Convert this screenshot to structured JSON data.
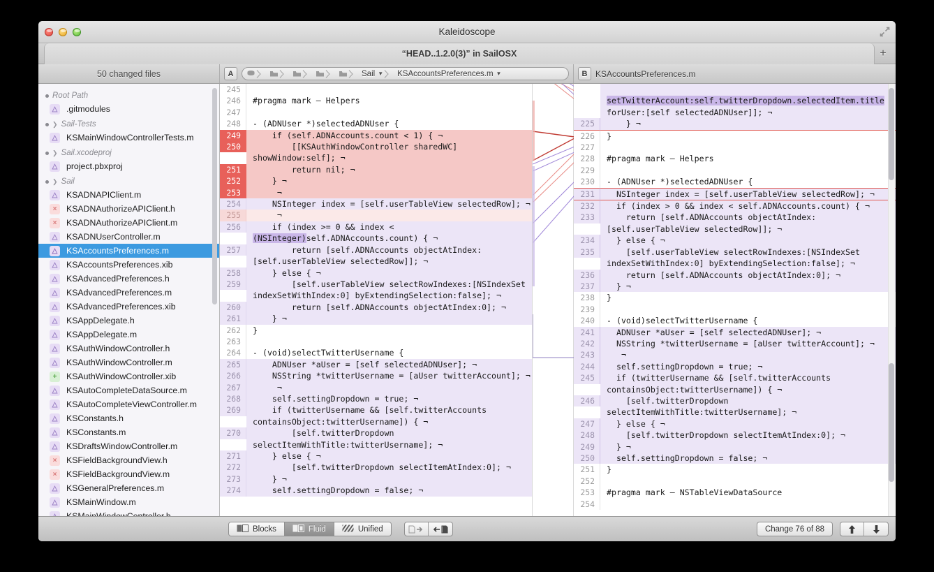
{
  "window": {
    "title": "Kaleidoscope",
    "subtitle": "“HEAD..1.2.0(3)” in SailOSX",
    "new_tab_label": "+"
  },
  "sidebar": {
    "header": "50 changed files",
    "groups": [
      {
        "name": "Root Path",
        "collapsible": false,
        "files": [
          {
            "name": ".gitmodules",
            "status": "mod"
          }
        ]
      },
      {
        "name": "Sail-Tests",
        "collapsible": true,
        "files": [
          {
            "name": "KSMainWindowControllerTests.m",
            "status": "mod"
          }
        ]
      },
      {
        "name": "Sail.xcodeproj",
        "collapsible": true,
        "files": [
          {
            "name": "project.pbxproj",
            "status": "mod"
          }
        ]
      },
      {
        "name": "Sail",
        "collapsible": true,
        "files": [
          {
            "name": "KSADNAPIClient.m",
            "status": "mod"
          },
          {
            "name": "KSADNAuthorizeAPIClient.h",
            "status": "del"
          },
          {
            "name": "KSADNAuthorizeAPIClient.m",
            "status": "del"
          },
          {
            "name": "KSADNUserController.m",
            "status": "mod"
          },
          {
            "name": "KSAccountsPreferences.m",
            "status": "mod",
            "selected": true
          },
          {
            "name": "KSAccountsPreferences.xib",
            "status": "mod"
          },
          {
            "name": "KSAdvancedPreferences.h",
            "status": "mod"
          },
          {
            "name": "KSAdvancedPreferences.m",
            "status": "mod"
          },
          {
            "name": "KSAdvancedPreferences.xib",
            "status": "mod"
          },
          {
            "name": "KSAppDelegate.h",
            "status": "mod"
          },
          {
            "name": "KSAppDelegate.m",
            "status": "mod"
          },
          {
            "name": "KSAuthWindowController.h",
            "status": "mod"
          },
          {
            "name": "KSAuthWindowController.m",
            "status": "mod"
          },
          {
            "name": "KSAuthWindowController.xib",
            "status": "add"
          },
          {
            "name": "KSAutoCompleteDataSource.m",
            "status": "mod"
          },
          {
            "name": "KSAutoCompleteViewController.m",
            "status": "mod"
          },
          {
            "name": "KSConstants.h",
            "status": "mod"
          },
          {
            "name": "KSConstants.m",
            "status": "mod"
          },
          {
            "name": "KSDraftsWindowController.m",
            "status": "mod"
          },
          {
            "name": "KSFieldBackgroundView.h",
            "status": "del"
          },
          {
            "name": "KSFieldBackgroundView.m",
            "status": "del"
          },
          {
            "name": "KSGeneralPreferences.m",
            "status": "mod"
          },
          {
            "name": "KSMainWindow.m",
            "status": "mod"
          },
          {
            "name": "KSMainWindowController.h",
            "status": "mod"
          }
        ]
      }
    ]
  },
  "pane_a": {
    "badge": "A",
    "breadcrumbs": [
      "Sail",
      "KSAccountsPreferences.m"
    ],
    "lines": [
      {
        "n": "245",
        "state": "",
        "code": ""
      },
      {
        "n": "246",
        "state": "",
        "code": "#pragma mark — Helpers"
      },
      {
        "n": "247",
        "state": "",
        "code": ""
      },
      {
        "n": "248",
        "state": "",
        "code": "- (ADNUser *)selectedADNUser {"
      },
      {
        "n": "249",
        "state": "del",
        "code": "    if (self.ADNAccounts.count < 1) { ¬"
      },
      {
        "n": "250",
        "state": "del",
        "code": "        [[KSAuthWindowController sharedWC] showWindow:self]; ¬"
      },
      {
        "n": "251",
        "state": "del",
        "code": "        return nil; ¬"
      },
      {
        "n": "252",
        "state": "del",
        "code": "    } ¬"
      },
      {
        "n": "253",
        "state": "del",
        "code": "     ¬"
      },
      {
        "n": "254",
        "state": "chg",
        "code": "    NSInteger index = [self.userTableView selectedRow]; ¬"
      },
      {
        "n": "255",
        "state": "delsoft",
        "code": "     ¬"
      },
      {
        "n": "256",
        "state": "chg",
        "code": "    if (index >= 0 && index < (NSInteger)self.ADNAccounts.count) { ¬"
      },
      {
        "n": "257",
        "state": "chg",
        "code": "        return [self.ADNAccounts objectAtIndex:[self.userTableView selectedRow]]; ¬"
      },
      {
        "n": "258",
        "state": "chg",
        "code": "    } else { ¬"
      },
      {
        "n": "259",
        "state": "chg",
        "code": "        [self.userTableView selectRowIndexes:[NSIndexSet indexSetWithIndex:0] byExtendingSelection:false]; ¬"
      },
      {
        "n": "260",
        "state": "chg",
        "code": "        return [self.ADNAccounts objectAtIndex:0]; ¬"
      },
      {
        "n": "261",
        "state": "chg",
        "code": "    } ¬"
      },
      {
        "n": "262",
        "state": "",
        "code": "}"
      },
      {
        "n": "263",
        "state": "",
        "code": ""
      },
      {
        "n": "264",
        "state": "",
        "code": "- (void)selectTwitterUsername {"
      },
      {
        "n": "265",
        "state": "chg",
        "code": "    ADNUser *aUser = [self selectedADNUser]; ¬"
      },
      {
        "n": "266",
        "state": "chg",
        "code": "    NSString *twitterUsername = [aUser twitterAccount]; ¬"
      },
      {
        "n": "267",
        "state": "chg",
        "code": "     ¬"
      },
      {
        "n": "268",
        "state": "chg",
        "code": "    self.settingDropdown = true; ¬"
      },
      {
        "n": "269",
        "state": "chg",
        "code": "    if (twitterUsername && [self.twitterAccounts containsObject:twitterUsername]) { ¬"
      },
      {
        "n": "270",
        "state": "chg",
        "code": "        [self.twitterDropdown selectItemWithTitle:twitterUsername]; ¬"
      },
      {
        "n": "271",
        "state": "chg",
        "code": "    } else { ¬"
      },
      {
        "n": "272",
        "state": "chg",
        "code": "        [self.twitterDropdown selectItemAtIndex:0]; ¬"
      },
      {
        "n": "273",
        "state": "chg",
        "code": "    } ¬"
      },
      {
        "n": "274",
        "state": "chg",
        "code": "    self.settingDropdown = false; ¬"
      }
    ]
  },
  "pane_b": {
    "badge": "B",
    "filename": "KSAccountsPreferences.m",
    "lines": [
      {
        "n": "",
        "state": "chgb",
        "code": "    setTwitterAccount:self.twitterDropdown.selectedItem.title forUser:[self selectedADNUser]]; ¬"
      },
      {
        "n": "225",
        "state": "chgb outline-bottom",
        "code": "    } ¬"
      },
      {
        "n": "226",
        "state": "",
        "code": "}"
      },
      {
        "n": "227",
        "state": "",
        "code": ""
      },
      {
        "n": "228",
        "state": "",
        "code": "#pragma mark — Helpers"
      },
      {
        "n": "229",
        "state": "",
        "code": ""
      },
      {
        "n": "230",
        "state": "",
        "code": "- (ADNUser *)selectedADNUser {"
      },
      {
        "n": "231",
        "state": "chgb outline-top outline-bottom",
        "code": "  NSInteger index = [self.userTableView selectedRow]; ¬"
      },
      {
        "n": "232",
        "state": "chgb",
        "code": "  if (index > 0 && index < self.ADNAccounts.count) { ¬"
      },
      {
        "n": "233",
        "state": "chgb",
        "code": "    return [self.ADNAccounts objectAtIndex:[self.userTableView selectedRow]]; ¬"
      },
      {
        "n": "234",
        "state": "chgb",
        "code": "  } else { ¬"
      },
      {
        "n": "235",
        "state": "chgb",
        "code": "    [self.userTableView selectRowIndexes:[NSIndexSet indexSetWithIndex:0] byExtendingSelection:false]; ¬"
      },
      {
        "n": "236",
        "state": "chgb",
        "code": "    return [self.ADNAccounts objectAtIndex:0]; ¬"
      },
      {
        "n": "237",
        "state": "chgb",
        "code": "  } ¬"
      },
      {
        "n": "238",
        "state": "",
        "code": "}"
      },
      {
        "n": "239",
        "state": "",
        "code": ""
      },
      {
        "n": "240",
        "state": "",
        "code": "- (void)selectTwitterUsername {"
      },
      {
        "n": "241",
        "state": "chgb",
        "code": "  ADNUser *aUser = [self selectedADNUser]; ¬"
      },
      {
        "n": "242",
        "state": "chgb",
        "code": "  NSString *twitterUsername = [aUser twitterAccount]; ¬"
      },
      {
        "n": "243",
        "state": "chgb",
        "code": "   ¬"
      },
      {
        "n": "244",
        "state": "chgb",
        "code": "  self.settingDropdown = true; ¬"
      },
      {
        "n": "245",
        "state": "chgb",
        "code": "  if (twitterUsername && [self.twitterAccounts containsObject:twitterUsername]) { ¬"
      },
      {
        "n": "246",
        "state": "chgb",
        "code": "    [self.twitterDropdown selectItemWithTitle:twitterUsername]; ¬"
      },
      {
        "n": "247",
        "state": "chgb",
        "code": "  } else { ¬"
      },
      {
        "n": "248",
        "state": "chgb",
        "code": "    [self.twitterDropdown selectItemAtIndex:0]; ¬"
      },
      {
        "n": "249",
        "state": "chgb",
        "code": "  } ¬"
      },
      {
        "n": "250",
        "state": "chgb",
        "code": "  self.settingDropdown = false; ¬"
      },
      {
        "n": "251",
        "state": "",
        "code": "}"
      },
      {
        "n": "252",
        "state": "",
        "code": ""
      },
      {
        "n": "253",
        "state": "",
        "code": "#pragma mark — NSTableViewDataSource"
      },
      {
        "n": "254",
        "state": "",
        "code": ""
      }
    ]
  },
  "bottom": {
    "view_modes": [
      {
        "label": "Blocks",
        "selected": false
      },
      {
        "label": "Fluid",
        "selected": true
      },
      {
        "label": "Unified",
        "selected": false
      }
    ],
    "apply_right_title": "Apply to right",
    "apply_left_title": "Apply to left",
    "change_counter": "Change 76 of 88",
    "prev_change_title": "Previous change",
    "next_change_title": "Next change"
  },
  "colors": {
    "selection_blue": "#3c9ae0",
    "delete_red": "#e8605a",
    "change_purple": "#ece5f7",
    "token_purple": "#c9b6e8",
    "add_green": "#5aa84d"
  }
}
